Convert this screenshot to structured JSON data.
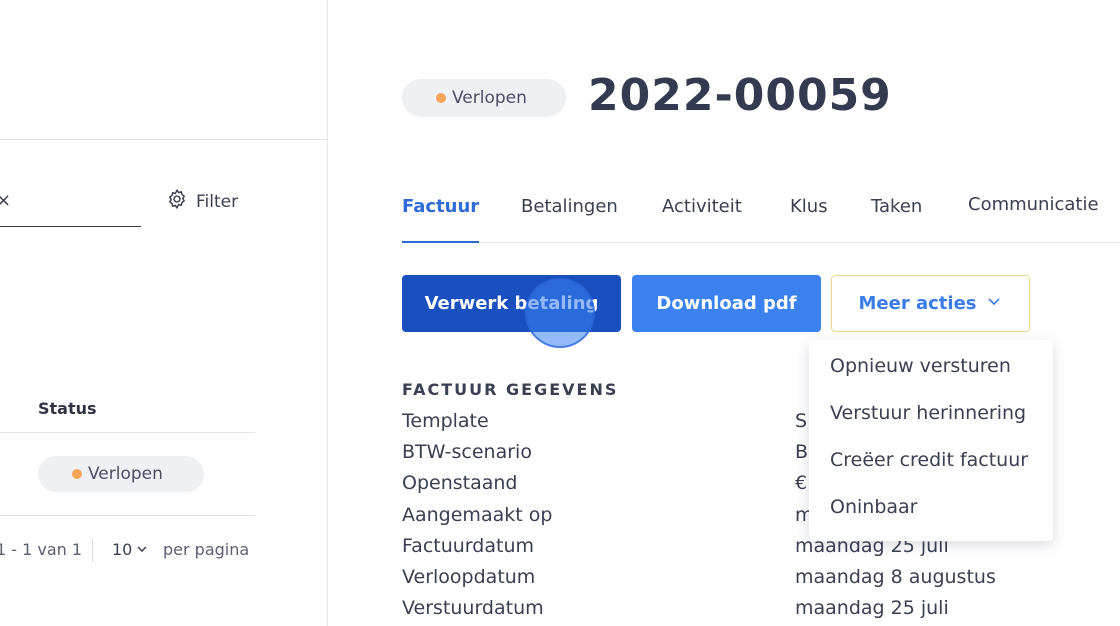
{
  "list": {
    "filter_label": "Filter",
    "search_clear": "×",
    "columns": {
      "status": "Status"
    },
    "rows": [
      {
        "status": "Verlopen"
      }
    ],
    "pagination": {
      "range": "1 - 1 van 1",
      "page_size": "10",
      "per_page": "per pagina"
    }
  },
  "detail": {
    "status": "Verlopen",
    "invoice_number": "2022-00059",
    "tabs": [
      {
        "label": "Factuur",
        "active": true
      },
      {
        "label": "Betalingen"
      },
      {
        "label": "Activiteit"
      },
      {
        "label": "Klus"
      },
      {
        "label": "Taken"
      },
      {
        "label": "Communicatie"
      }
    ],
    "actions": {
      "process_payment": "Verwerk betaling",
      "download_pdf": "Download pdf",
      "more_actions": "Meer acties"
    },
    "more_menu": [
      {
        "label": "Opnieuw versturen"
      },
      {
        "label": "Verstuur herinnering"
      },
      {
        "label": "Creëer credit factuur"
      },
      {
        "label": "Oninbaar"
      }
    ],
    "section_title": "FACTUUR GEGEVENS",
    "fields": [
      {
        "label": "Template",
        "value": "S"
      },
      {
        "label": "BTW-scenario",
        "value": "B"
      },
      {
        "label": "Openstaand",
        "value": "€"
      },
      {
        "label": "Aangemaakt op",
        "value": "m"
      },
      {
        "label": "Factuurdatum",
        "value": "maandag 25 juli"
      },
      {
        "label": "Verloopdatum",
        "value": "maandag 8 augustus"
      },
      {
        "label": "Verstuurdatum",
        "value": "maandag 25 juli"
      }
    ]
  },
  "colors": {
    "status_dot": "#f6a458",
    "primary": "#1a4fbf",
    "secondary": "#3b82f0",
    "tab_active": "#2f6bd8",
    "outline_border": "#ecd48a"
  },
  "icons": {
    "filter": "gear-icon",
    "dropdown": "chevron-down-icon",
    "page_size": "chevron-down-icon"
  }
}
